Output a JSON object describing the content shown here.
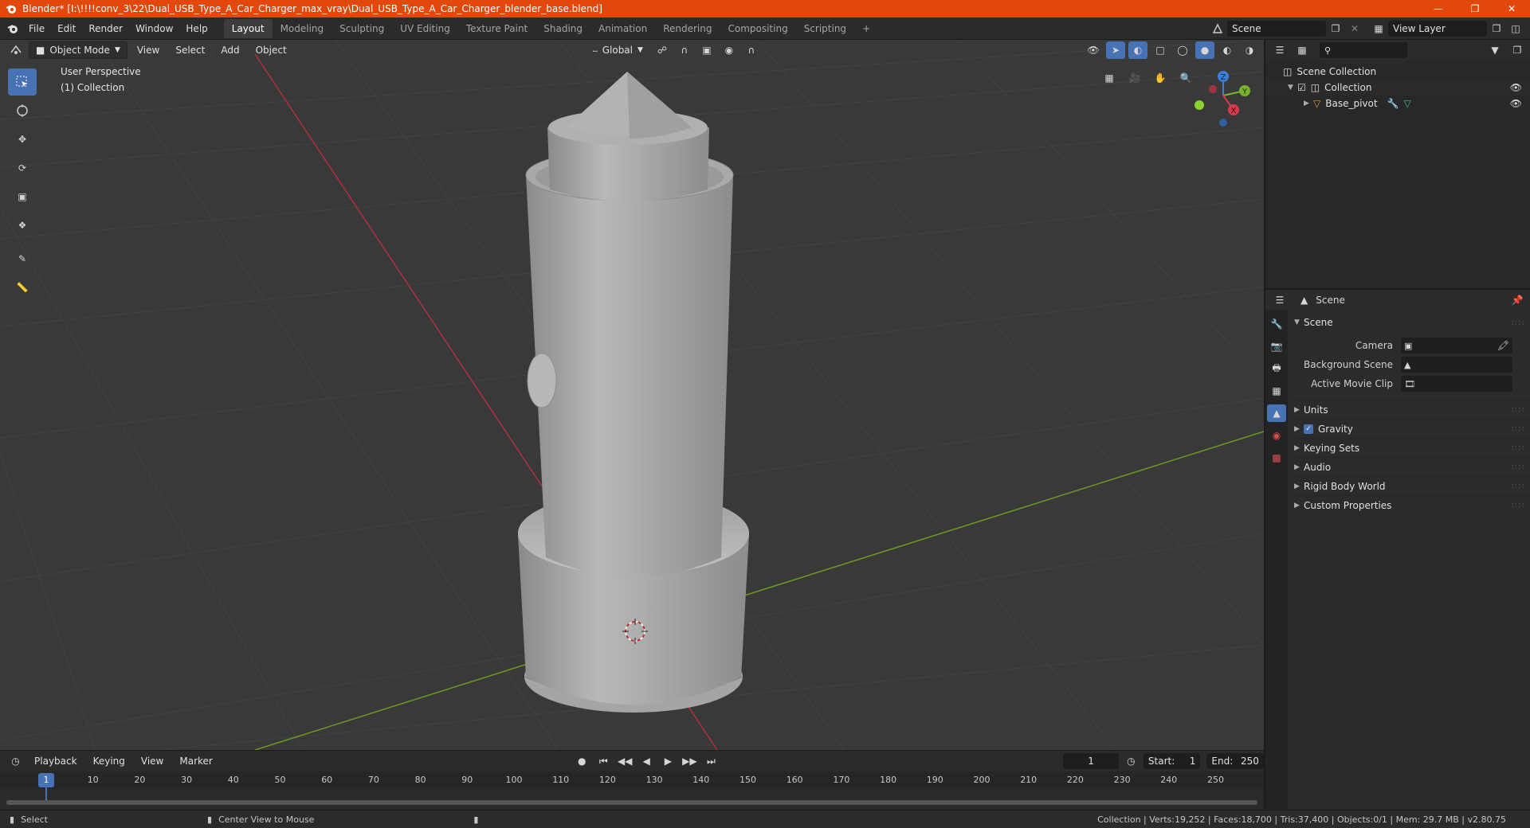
{
  "window": {
    "title": "Blender* [I:\\!!!!conv_3\\22\\Dual_USB_Type_A_Car_Charger_max_vray\\Dual_USB_Type_A_Car_Charger_blender_base.blend]"
  },
  "menubar": {
    "menus": [
      "File",
      "Edit",
      "Render",
      "Window",
      "Help"
    ],
    "workspaces": [
      "Layout",
      "Modeling",
      "Sculpting",
      "UV Editing",
      "Texture Paint",
      "Shading",
      "Animation",
      "Rendering",
      "Compositing",
      "Scripting"
    ],
    "active_workspace": "Layout",
    "add_tab": "+",
    "scene_name": "Scene",
    "view_layer_name": "View Layer"
  },
  "viewport": {
    "mode": "Object Mode",
    "menus": [
      "View",
      "Select",
      "Add",
      "Object"
    ],
    "orientation": "Global",
    "perspective_label": "User Perspective",
    "collection_label": "(1) Collection",
    "axis_labels": {
      "x": "X",
      "y": "Y",
      "z": "Z"
    }
  },
  "outliner": {
    "search_placeholder": "",
    "scene_collection": "Scene Collection",
    "collection": "Collection",
    "object": "Base_pivot"
  },
  "properties": {
    "header_title": "Scene",
    "panel_title": "Scene",
    "camera_label": "Camera",
    "background_scene_label": "Background Scene",
    "active_movie_clip_label": "Active Movie Clip",
    "sub_panels": [
      "Units",
      "Gravity",
      "Keying Sets",
      "Audio",
      "Rigid Body World",
      "Custom Properties"
    ]
  },
  "timeline": {
    "menus": [
      "Playback",
      "Keying",
      "View",
      "Marker"
    ],
    "current_frame": "1",
    "start_label": "Start:",
    "start_value": "1",
    "end_label": "End:",
    "end_value": "250",
    "ticks": [
      "1",
      "10",
      "20",
      "30",
      "40",
      "50",
      "60",
      "70",
      "80",
      "90",
      "100",
      "110",
      "120",
      "130",
      "140",
      "150",
      "160",
      "170",
      "180",
      "190",
      "200",
      "210",
      "220",
      "230",
      "240",
      "250"
    ]
  },
  "statusbar": {
    "left_action": "Select",
    "middle_action": "Center View to Mouse",
    "stats": "Collection | Verts:19,252 | Faces:18,700 | Tris:37,400 | Objects:0/1 | Mem: 29.7 MB | v2.80.75"
  },
  "colors": {
    "title_bar": "#e2470b",
    "accent": "#4772b3",
    "x_axis": "#d93a49",
    "y_axis": "#7ab22e",
    "z_axis": "#3c7fd9"
  }
}
